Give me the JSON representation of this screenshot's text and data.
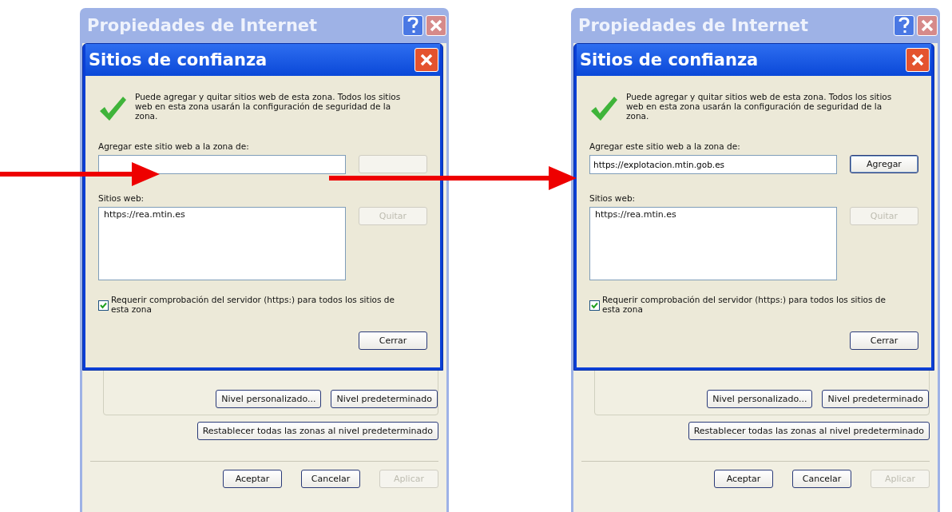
{
  "panels": [
    {
      "outer_window": {
        "title": "Propiedades de Internet",
        "level_buttons": [
          {
            "label": "Nivel personalizado...",
            "disabled": false
          },
          {
            "label": "Nivel predeterminado",
            "disabled": false
          }
        ],
        "reset_button": {
          "label": "Restablecer todas las zonas al nivel predeterminado",
          "disabled": false
        },
        "footer_buttons": [
          {
            "label": "Aceptar",
            "disabled": false
          },
          {
            "label": "Cancelar",
            "disabled": false
          },
          {
            "label": "Aplicar",
            "disabled": true
          }
        ]
      },
      "dialog": {
        "title": "Sitios de confianza",
        "description": "Puede agregar y quitar sitios web de esta zona. Todos los sitios web en esta zona usarán la configuración de seguridad de la zona.",
        "add_label": "Agregar este sitio web a la zona de:",
        "add_button": {
          "disabled": true
        },
        "sites_label": "Sitios web:",
        "sites": [
          "https://rea.mtin.es"
        ],
        "remove_button": {
          "label": "Quitar",
          "disabled": true
        },
        "https_required": {
          "label": "Requerir comprobación del servidor (https:) para todos los sitios de esta zona",
          "checked": true
        },
        "close_button": {
          "label": "Cerrar",
          "disabled": false
        }
      }
    },
    {
      "outer_window": {
        "title": "Propiedades de Internet",
        "level_buttons": [
          {
            "label": "Nivel personalizado...",
            "disabled": false
          },
          {
            "label": "Nivel predeterminado",
            "disabled": false
          }
        ],
        "reset_button": {
          "label": "Restablecer todas las zonas al nivel predeterminado",
          "disabled": false
        },
        "footer_buttons": [
          {
            "label": "Aceptar",
            "disabled": false
          },
          {
            "label": "Cancelar",
            "disabled": false
          },
          {
            "label": "Aplicar",
            "disabled": true
          }
        ]
      },
      "dialog": {
        "title": "Sitios de confianza",
        "description": "Puede agregar y quitar sitios web de esta zona. Todos los sitios web en esta zona usarán la configuración de seguridad de la zona.",
        "add_label": "Agregar este sitio web a la zona de:",
        "add_value": "https://explotacion.mtin.gob.es",
        "add_button": {
          "label": "Agregar",
          "disabled": false
        },
        "sites_label": "Sitios web:",
        "sites": [
          "https://rea.mtin.es"
        ],
        "remove_button": {
          "label": "Quitar",
          "disabled": true
        },
        "https_required": {
          "label": "Requerir comprobación del servidor (https:) para todos los sitios de esta zona",
          "checked": true
        },
        "close_button": {
          "label": "Cerrar",
          "disabled": false
        }
      }
    }
  ]
}
